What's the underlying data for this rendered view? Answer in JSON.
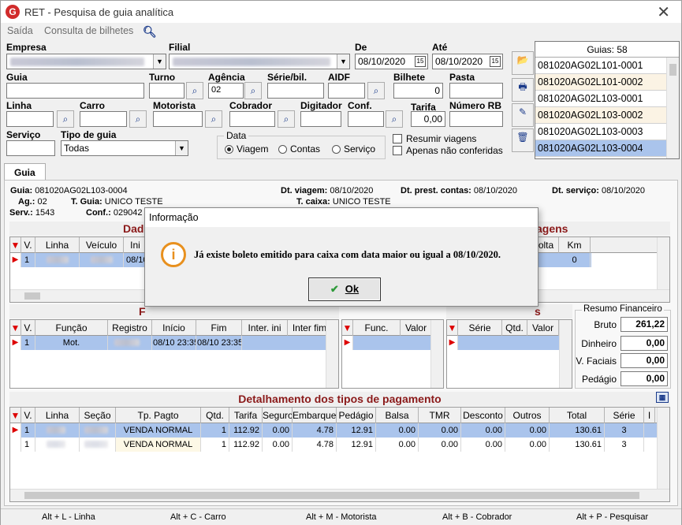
{
  "window": {
    "title": "RET - Pesquisa de guia analítica",
    "close": "✕"
  },
  "menu": [
    "Saída",
    "Consulta de bilhetes"
  ],
  "filters": {
    "empresa_label": "Empresa",
    "filial_label": "Filial",
    "de_label": "De",
    "de_value": "08/10/2020",
    "ate_label": "Até",
    "ate_value": "08/10/2020",
    "guia_label": "Guia",
    "turno_label": "Turno",
    "agencia_label": "Agência",
    "agencia_value": "02",
    "serie_label": "Série/bil.",
    "aidf_label": "AIDF",
    "bilhete_label": "Bilhete",
    "bilhete_value": "0",
    "pasta_label": "Pasta",
    "linha_label": "Linha",
    "carro_label": "Carro",
    "motorista_label": "Motorista",
    "cobrador_label": "Cobrador",
    "digitador_label": "Digitador",
    "conf_label": "Conf.",
    "tarifa_label": "Tarifa",
    "tarifa_value": "0,00",
    "numero_rb_label": "Número RB",
    "servico_label": "Serviço",
    "tipo_guia_label": "Tipo de guia",
    "tipo_guia_value": "Todas",
    "data_group_label": "Data",
    "data_options": [
      "Viagem",
      "Contas",
      "Serviço"
    ],
    "resumir_viagens": "Resumir viagens",
    "apenas_nao_conferidas": "Apenas não conferidas"
  },
  "guias_list": {
    "header": "Guias: 58",
    "items": [
      "081020AG02L101-0001",
      "081020AG02L101-0002",
      "081020AG02L103-0001",
      "081020AG02L103-0002",
      "081020AG02L103-0003",
      "081020AG02L103-0004"
    ]
  },
  "tab": "Guia",
  "guia_info": {
    "guia_label": "Guia:",
    "guia_value": "081020AG02L103-0004",
    "dt_viagem_label": "Dt. viagem:",
    "dt_viagem_value": "08/10/2020",
    "dt_prest_label": "Dt. prest. contas:",
    "dt_prest_value": "08/10/2020",
    "dt_servico_label": "Dt. serviço:",
    "dt_servico_value": "08/10/2020",
    "ag_label": "Ag.:",
    "ag_value": "02",
    "tguia_label": "T. Guia:",
    "tguia_value": "UNICO TESTE",
    "tcaixa_label": "T. caixa:",
    "tcaixa_value": "UNICO TESTE",
    "serv_label": "Serv.:",
    "serv_value": "1543",
    "conf_label": "Conf.:",
    "conf_value": "029042"
  },
  "viagens": {
    "title_left": "Dad",
    "title_right": "agens",
    "columns": [
      "V.",
      "Linha",
      "Veículo",
      "Ini",
      "olta",
      "Km"
    ],
    "row": {
      "v": "1",
      "ini": "08/10",
      "km": "0"
    }
  },
  "funcoes": {
    "title": "F",
    "columns": [
      "V.",
      "Função",
      "Registro",
      "Início",
      "Fim",
      "Inter. ini",
      "Inter fim"
    ],
    "row": {
      "v": "1",
      "funcao": "Mot.",
      "inicio": "08/10 23:35",
      "fim": "08/10 23:35"
    }
  },
  "mid_grid": {
    "columns": [
      "Func.",
      "Valor"
    ]
  },
  "right_grid": {
    "title": "s",
    "columns": [
      "Série",
      "Qtd.",
      "Valor"
    ]
  },
  "resumo": {
    "title": "Resumo Financeiro",
    "rows": [
      {
        "label": "Bruto",
        "value": "261,22"
      },
      {
        "label": "Dinheiro",
        "value": "0,00"
      },
      {
        "label": "V. Faciais",
        "value": "0,00"
      },
      {
        "label": "Pedágio",
        "value": "0,00"
      }
    ]
  },
  "pagamentos": {
    "title": "Detalhamento dos tipos de pagamento",
    "columns": [
      "V.",
      "Linha",
      "Seção",
      "Tp. Pagto",
      "Qtd.",
      "Tarifa",
      "Seguro",
      "Embarque",
      "Pedágio",
      "Balsa",
      "TMR",
      "Desconto",
      "Outros",
      "Total",
      "Série",
      "I"
    ],
    "rows": [
      {
        "v": "1",
        "tp": "VENDA NORMAL",
        "qtd": "1",
        "tarifa": "112.92",
        "seguro": "0.00",
        "embarque": "4.78",
        "pedagio": "12.91",
        "balsa": "0.00",
        "tmr": "0.00",
        "desconto": "0.00",
        "outros": "0.00",
        "total": "130.61",
        "serie": "3"
      },
      {
        "v": "1",
        "tp": "VENDA NORMAL",
        "qtd": "1",
        "tarifa": "112.92",
        "seguro": "0.00",
        "embarque": "4.78",
        "pedagio": "12.91",
        "balsa": "0.00",
        "tmr": "0.00",
        "desconto": "0.00",
        "outros": "0.00",
        "total": "130.61",
        "serie": "3"
      }
    ]
  },
  "statusbar": [
    "Alt + L - Linha",
    "Alt + C - Carro",
    "Alt + M - Motorista",
    "Alt + B - Cobrador",
    "Alt + P - Pesquisar"
  ],
  "dialog": {
    "title": "Informação",
    "icon": "i",
    "message": "Já existe boleto emitido para caixa com data maior ou igual a 08/10/2020.",
    "ok_check": "✔",
    "ok_label": "Ok"
  }
}
